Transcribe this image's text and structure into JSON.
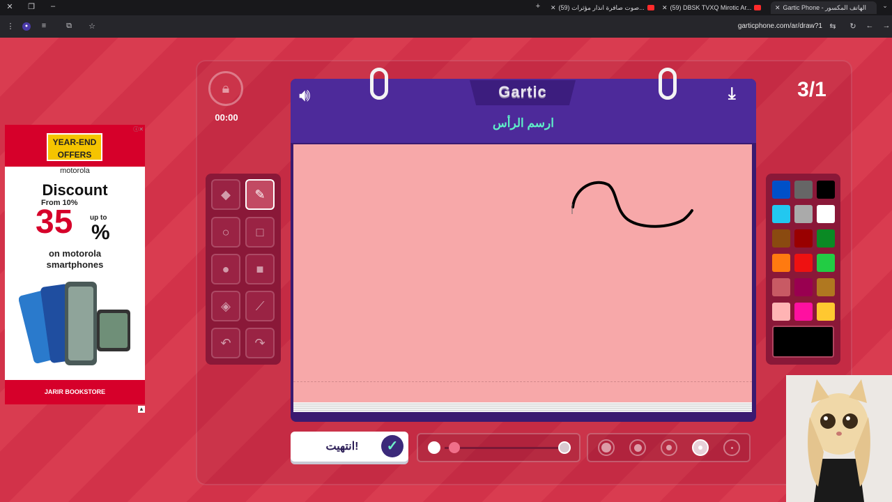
{
  "browser": {
    "tabs": [
      {
        "title": "Gartic Phone - الهاتف المكسور"
      },
      {
        "title": "(59) DBSK TVXQ Mirotic Ar..."
      },
      {
        "title": "(59) صوت صافرة انذار مؤثرات..."
      }
    ],
    "new_tab_label": "+",
    "url": "garticphone.com/ar/draw?1"
  },
  "game": {
    "logo": "Gartic",
    "prompt": "ارسم الرأس",
    "timer": "00:00",
    "round": "3/1",
    "done_label": "انتهيت!",
    "tools": [
      {
        "name": "eraser",
        "icon": "eraser-icon"
      },
      {
        "name": "pencil",
        "icon": "pencil-icon",
        "selected": true
      },
      {
        "name": "ellipse-outline",
        "icon": "circle-outline-icon"
      },
      {
        "name": "rectangle-outline",
        "icon": "square-outline-icon"
      },
      {
        "name": "ellipse-filled",
        "icon": "circle-filled-icon"
      },
      {
        "name": "rectangle-filled",
        "icon": "square-filled-icon"
      },
      {
        "name": "fill",
        "icon": "paint-bucket-icon"
      },
      {
        "name": "line",
        "icon": "line-tool-icon"
      },
      {
        "name": "undo",
        "icon": "undo-icon"
      },
      {
        "name": "redo",
        "icon": "redo-icon"
      }
    ],
    "palette": [
      "#0050c8",
      "#666666",
      "#000000",
      "#22c8f0",
      "#aaaaaa",
      "#ffffff",
      "#8a4a10",
      "#990000",
      "#0a8a24",
      "#ff7a10",
      "#ee1111",
      "#22cc44",
      "#c85a64",
      "#990050",
      "#b07820",
      "#ffb4b4",
      "#ff10a0",
      "#ffc830"
    ],
    "current_color": "#000000",
    "opacity_level": 1.0,
    "brush_sizes": 5,
    "selected_brush_size": 4
  },
  "ad": {
    "badge": "YEAR-END OFFERS",
    "brand": "motorola",
    "headline": "Discount",
    "from": "From 10%",
    "upto": "up to",
    "percent_value": "35",
    "percent_sign": "%",
    "line1": "on motorola",
    "line2": "smartphones",
    "footer": "JARIR BOOKSTORE"
  }
}
